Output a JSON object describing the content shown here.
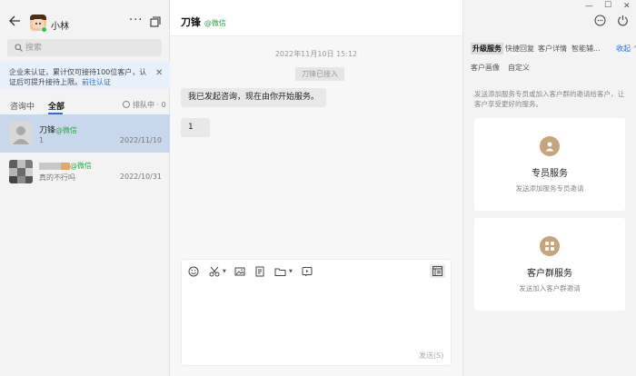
{
  "left": {
    "user_name": "小林",
    "search_placeholder": "搜索",
    "notice_text": "企业未认证，累计仅可接待100位客户，认证后可提升接待上限。",
    "notice_link": "前往认证",
    "tabs": {
      "consulting": "咨询中",
      "all": "全部"
    },
    "queue": "排队中 · 0",
    "conversations": [
      {
        "name": "刀锋",
        "source": "@微信",
        "last_message": "1",
        "date": "2022/11/10"
      },
      {
        "name": "",
        "source": "@微信",
        "last_message": "真的不行吗",
        "date": "2022/10/31"
      }
    ]
  },
  "chat": {
    "title": "刀锋",
    "source": "@微信",
    "timestamp": "2022年11月10日 15:12",
    "system_message": "刀锋已接入",
    "messages": [
      {
        "text": "我已发起咨询，现在由你开始服务。"
      },
      {
        "text": "1"
      }
    ],
    "send_label": "发送(S)"
  },
  "right": {
    "tabs_row1": [
      "升级服务",
      "快捷回复",
      "客户详情",
      "智能辅..."
    ],
    "collapse_label": "收起",
    "tabs_row2": [
      "客户画像",
      "自定义"
    ],
    "description": "发送添加服务专员或加入客户群的邀请给客户，让客户享受更好的服务。",
    "cards": [
      {
        "title": "专员服务",
        "subtitle": "发送添加服务专员邀请"
      },
      {
        "title": "客户群服务",
        "subtitle": "发送加入客户群邀请"
      }
    ]
  },
  "colors": {
    "accent": "#2e6fd6",
    "wechat_green": "#2ea44f",
    "selected_row": "#c9d7ec",
    "card_icon": "#c6a47c"
  }
}
